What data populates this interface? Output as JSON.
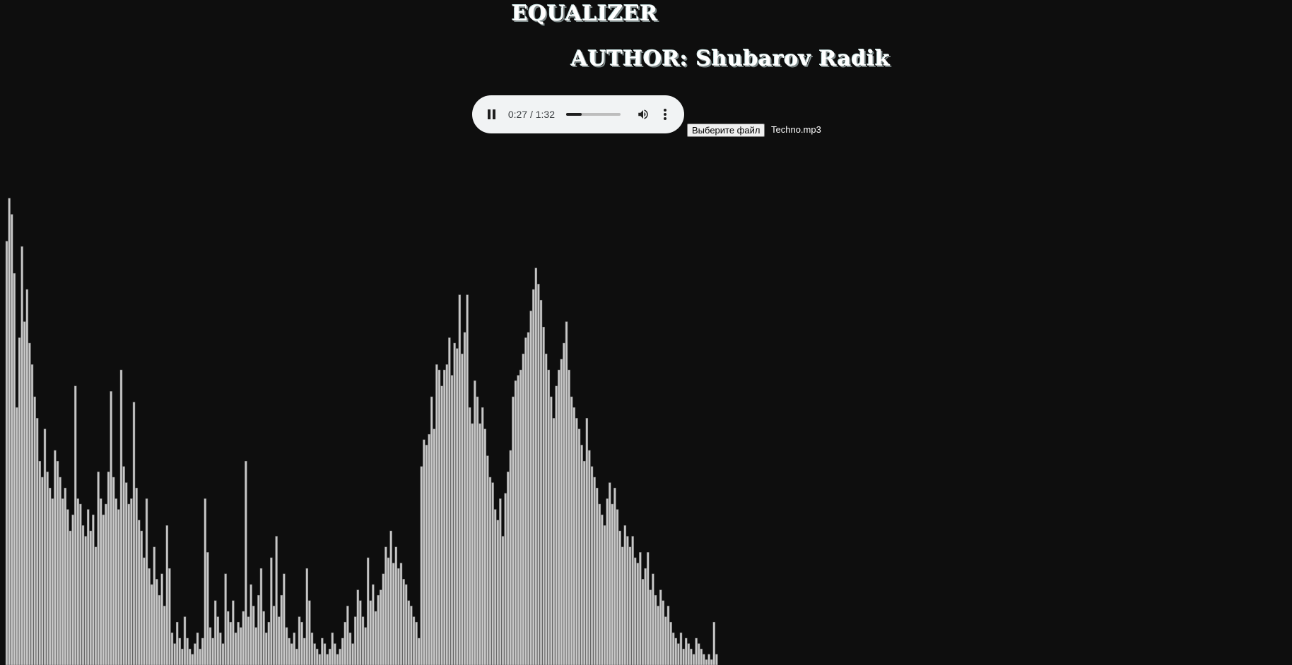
{
  "header": {
    "title": "EQUALIZER",
    "author": "AUTHOR: Shubarov Radik"
  },
  "player": {
    "time": "0:27 / 1:32",
    "progress_fraction": 0.29,
    "state": "playing",
    "icons": [
      "pause-icon",
      "volume-icon",
      "more-options-icon"
    ]
  },
  "file_input": {
    "button_label": "Выберите файл",
    "file_name": "Techno.mp3"
  },
  "colors": {
    "background": "#0e0e0e",
    "bar_fill": "#c8c8c8",
    "bar_edge": "#6e6e6e"
  },
  "chart_data": {
    "type": "bar",
    "values": [
      0.79,
      0.87,
      0.84,
      0.73,
      0.48,
      0.61,
      0.78,
      0.64,
      0.7,
      0.6,
      0.56,
      0.5,
      0.46,
      0.38,
      0.35,
      0.44,
      0.36,
      0.33,
      0.31,
      0.4,
      0.38,
      0.35,
      0.31,
      0.33,
      0.29,
      0.25,
      0.28,
      0.52,
      0.31,
      0.3,
      0.26,
      0.24,
      0.29,
      0.25,
      0.28,
      0.22,
      0.36,
      0.31,
      0.28,
      0.3,
      0.36,
      0.51,
      0.35,
      0.31,
      0.29,
      0.55,
      0.37,
      0.34,
      0.3,
      0.31,
      0.49,
      0.33,
      0.27,
      0.25,
      0.2,
      0.31,
      0.18,
      0.15,
      0.22,
      0.16,
      0.13,
      0.17,
      0.11,
      0.26,
      0.18,
      0.06,
      0.04,
      0.08,
      0.05,
      0.03,
      0.09,
      0.05,
      0.03,
      0.02,
      0.04,
      0.06,
      0.03,
      0.05,
      0.31,
      0.21,
      0.07,
      0.05,
      0.12,
      0.09,
      0.06,
      0.04,
      0.17,
      0.1,
      0.08,
      0.12,
      0.06,
      0.08,
      0.07,
      0.1,
      0.38,
      0.09,
      0.15,
      0.11,
      0.07,
      0.13,
      0.18,
      0.1,
      0.06,
      0.08,
      0.2,
      0.11,
      0.24,
      0.09,
      0.13,
      0.17,
      0.07,
      0.05,
      0.04,
      0.06,
      0.03,
      0.09,
      0.08,
      0.05,
      0.18,
      0.12,
      0.06,
      0.04,
      0.03,
      0.02,
      0.05,
      0.04,
      0.02,
      0.03,
      0.06,
      0.04,
      0.02,
      0.03,
      0.05,
      0.08,
      0.11,
      0.06,
      0.04,
      0.09,
      0.14,
      0.12,
      0.09,
      0.07,
      0.2,
      0.12,
      0.15,
      0.1,
      0.13,
      0.14,
      0.17,
      0.22,
      0.2,
      0.25,
      0.19,
      0.22,
      0.18,
      0.19,
      0.16,
      0.15,
      0.12,
      0.11,
      0.09,
      0.08,
      0.05,
      0.37,
      0.42,
      0.41,
      0.43,
      0.5,
      0.44,
      0.56,
      0.55,
      0.52,
      0.55,
      0.56,
      0.61,
      0.54,
      0.6,
      0.59,
      0.69,
      0.58,
      0.62,
      0.69,
      0.48,
      0.45,
      0.53,
      0.5,
      0.45,
      0.48,
      0.44,
      0.39,
      0.35,
      0.34,
      0.29,
      0.27,
      0.31,
      0.24,
      0.32,
      0.36,
      0.4,
      0.5,
      0.53,
      0.54,
      0.55,
      0.58,
      0.61,
      0.62,
      0.66,
      0.7,
      0.74,
      0.71,
      0.68,
      0.63,
      0.58,
      0.55,
      0.5,
      0.46,
      0.52,
      0.55,
      0.57,
      0.6,
      0.64,
      0.55,
      0.5,
      0.48,
      0.46,
      0.44,
      0.41,
      0.38,
      0.46,
      0.4,
      0.37,
      0.35,
      0.33,
      0.3,
      0.28,
      0.26,
      0.31,
      0.34,
      0.3,
      0.33,
      0.29,
      0.25,
      0.22,
      0.26,
      0.24,
      0.22,
      0.24,
      0.2,
      0.19,
      0.21,
      0.16,
      0.18,
      0.21,
      0.14,
      0.17,
      0.13,
      0.11,
      0.14,
      0.12,
      0.09,
      0.11,
      0.08,
      0.06,
      0.05,
      0.04,
      0.06,
      0.03,
      0.05,
      0.04,
      0.03,
      0.02,
      0.05,
      0.04,
      0.03,
      0.02,
      0.01,
      0.02,
      0.01,
      0.08,
      0.02
    ]
  }
}
